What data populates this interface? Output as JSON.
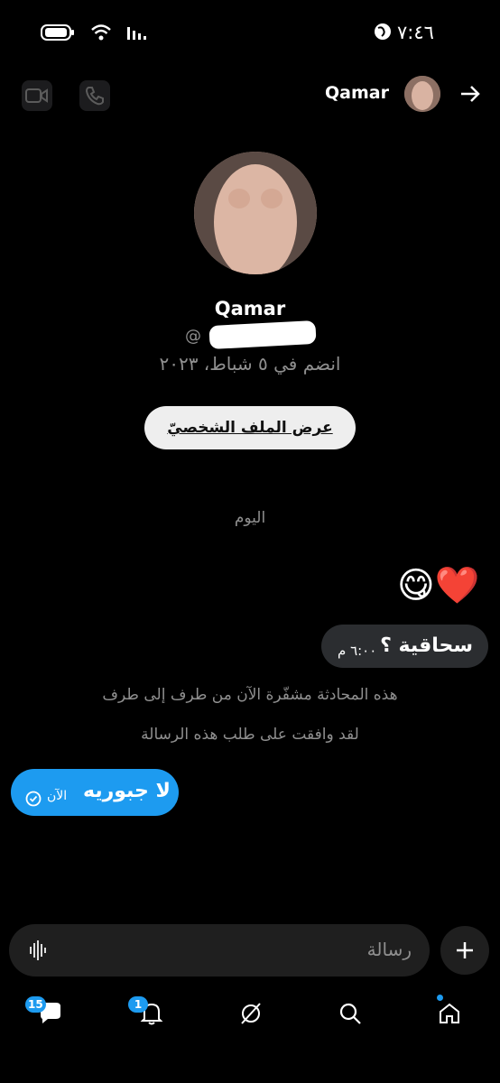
{
  "status_bar": {
    "time": "٧:٤٦"
  },
  "header": {
    "name": "Qamar"
  },
  "profile": {
    "name": "Qamar",
    "handle_prefix": "@",
    "joined": "انضم في ٥ شباط، ٢٠٢٣",
    "view_profile_label": "عرض الملف الشخصيّ"
  },
  "conversation": {
    "day_label": "اليوم",
    "reaction_emojis": "😋❤️",
    "incoming": {
      "text": "سحاقية ؟",
      "time": "٦:٠٠ م"
    },
    "encryption_notice": "هذه المحادثة مشفّرة الآن من طرف إلى طرف",
    "accepted_notice": "لقد وافقت على طلب هذه الرسالة",
    "outgoing": {
      "text": "لا جبوريه",
      "time": "الآن"
    }
  },
  "composer": {
    "placeholder": "رسالة"
  },
  "bottom_nav": {
    "messages_badge": "15",
    "notifications_badge": "1"
  },
  "colors": {
    "accent": "#1d9bf0",
    "bubble_in": "#2b2d30",
    "muted": "#8f8f8f"
  }
}
